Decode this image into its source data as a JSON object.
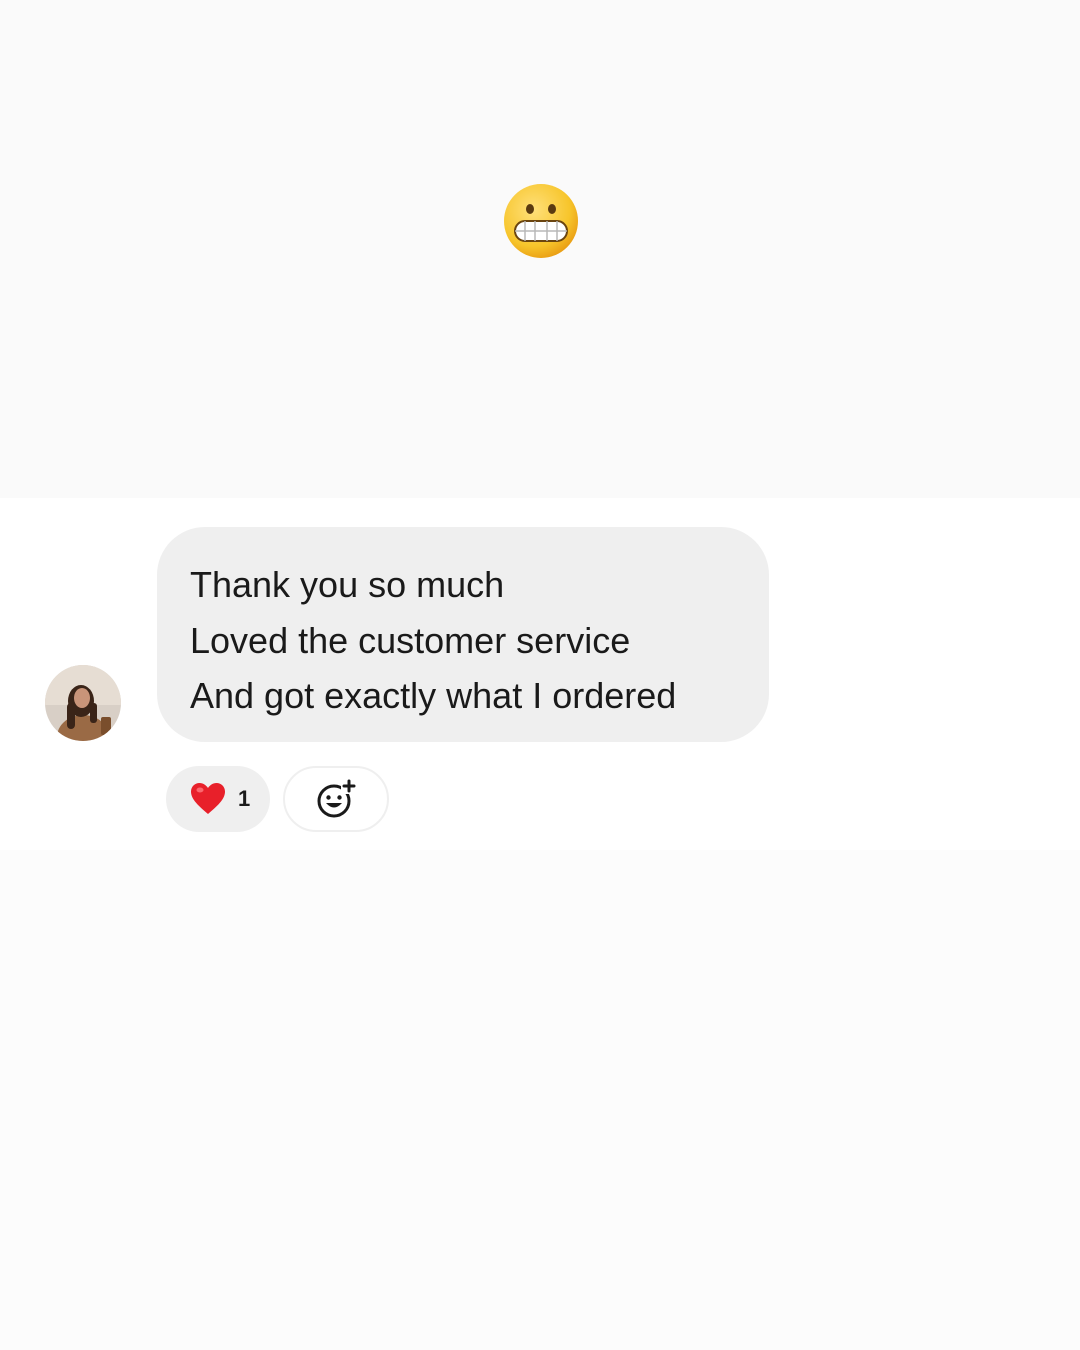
{
  "top_emoji": {
    "icon": "grimacing-face-icon"
  },
  "message": {
    "sender_avatar": "avatar-photo-icon",
    "lines": [
      "Thank you so much",
      "Loved the customer service",
      "And got exactly what I ordered"
    ],
    "bubble_color": "#efefef"
  },
  "reactions": {
    "items": [
      {
        "icon": "red-heart-icon",
        "count": "1"
      }
    ],
    "add_reaction_icon": "add-reaction-icon"
  },
  "colors": {
    "background": "#fafafa",
    "message_background": "#ffffff",
    "heart": "#e8202a",
    "emoji_yellow": "#f7c52b"
  }
}
